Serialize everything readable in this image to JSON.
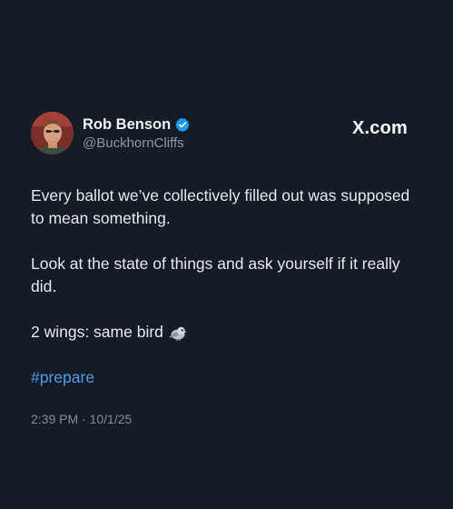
{
  "author": {
    "display_name": "Rob Benson",
    "handle": "@BuckhornCliffs",
    "verified": true,
    "avatar_icon": "profile-photo"
  },
  "brand": {
    "label": "X.com"
  },
  "post": {
    "paragraph_1": "Every ballot we’ve collectively filled out was supposed to mean something.",
    "paragraph_2": "Look at the state of things and ask yourself if it really did.",
    "paragraph_3": "2 wings: same bird",
    "emoji_icon": "bird-emoji",
    "hashtag": "#prepare",
    "timestamp": "2:39 PM · 10/1/25"
  },
  "colors": {
    "background": "#151c26",
    "text": "#e7e9ea",
    "secondary_text": "#8b98a5",
    "link": "#4a9ee8",
    "verified_badge": "#1d9bf0"
  }
}
